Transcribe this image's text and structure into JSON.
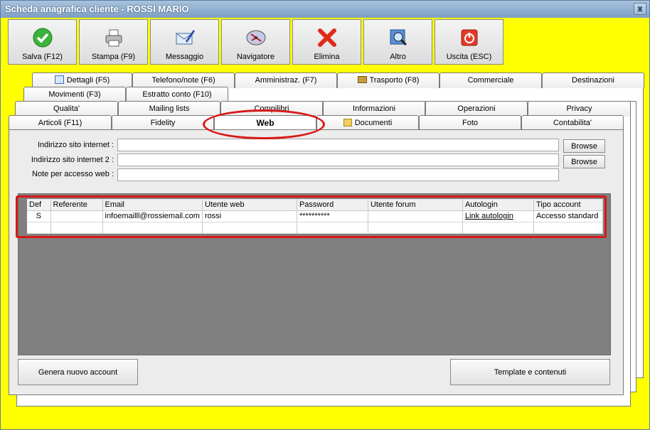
{
  "window": {
    "title": "Scheda anagrafica cliente - ROSSI MARIO",
    "close_glyph": "x"
  },
  "colors": {
    "background": "#ffff00",
    "annotation": "#d81818",
    "grid_bg": "#808080"
  },
  "toolbar": [
    {
      "label": "Salva (F12)",
      "icon": "checkmark-icon"
    },
    {
      "label": "Stampa (F9)",
      "icon": "printer-icon"
    },
    {
      "label": "Messaggio",
      "icon": "envelope-pen-icon"
    },
    {
      "label": "Navigatore",
      "icon": "compass-icon"
    },
    {
      "label": "Elimina",
      "icon": "red-x-icon"
    },
    {
      "label": "Altro",
      "icon": "search-icon"
    },
    {
      "label": "Uscita (ESC)",
      "icon": "power-icon"
    }
  ],
  "tabs": {
    "row1": [
      "Dettagli (F5)",
      "Telefono/note (F6)",
      "Amministraz. (F7)",
      "Trasporto (F8)",
      "Commerciale",
      "Destinazioni"
    ],
    "row2": [
      "Movimenti (F3)",
      "Estratto conto (F10)"
    ],
    "row3": [
      "Qualita'",
      "Mailing lists",
      "Compilibri",
      "Informazioni",
      "Operazioni",
      "Privacy"
    ],
    "row4": [
      "Articoli (F11)",
      "Fidelity",
      "Web",
      "Documenti",
      "Foto",
      "Contabilita'"
    ],
    "active": "Web"
  },
  "form": {
    "site1_label": "Indirizzo sito internet :",
    "site2_label": "Indirizzo sito internet 2 :",
    "notes_label": "Note per accesso web :",
    "site1_value": "",
    "site2_value": "",
    "notes_value": "",
    "browse_label": "Browse"
  },
  "grid": {
    "columns": [
      "Def",
      "Referente",
      "Email",
      "Utente web",
      "Password",
      "Utente forum",
      "Autologin",
      "Tipo account"
    ],
    "rows": [
      [
        "S",
        "",
        "infoemailll@rossiemail.com",
        "rossi",
        "**********",
        "",
        "Link autologin",
        "Accesso standard"
      ],
      [
        "",
        "",
        "",
        "",
        "",
        "",
        "",
        ""
      ]
    ]
  },
  "buttons": {
    "new_account": "Genera nuovo account",
    "templates": "Template e contenuti"
  }
}
